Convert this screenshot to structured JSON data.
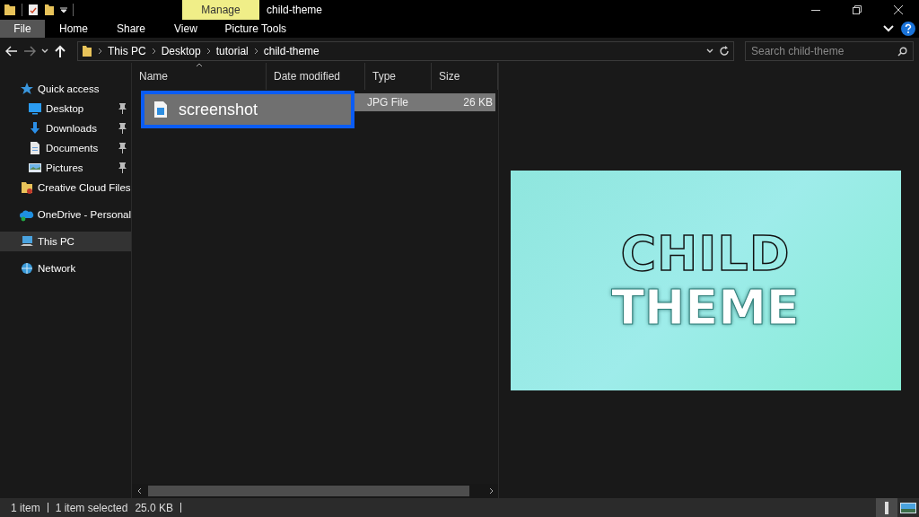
{
  "window": {
    "title": "child-theme",
    "context_group": "Manage"
  },
  "ribbon_tabs": [
    {
      "label": "File",
      "kind": "file"
    },
    {
      "label": "Home",
      "kind": "normal"
    },
    {
      "label": "Share",
      "kind": "normal"
    },
    {
      "label": "View",
      "kind": "normal"
    },
    {
      "label": "Picture Tools",
      "kind": "context"
    }
  ],
  "address": {
    "path": [
      "This PC",
      "Desktop",
      "tutorial",
      "child-theme"
    ]
  },
  "search": {
    "placeholder": "Search child-theme"
  },
  "sidebar": {
    "items": [
      {
        "label": "Quick access",
        "kind": "star",
        "selected": false,
        "children": [
          {
            "label": "Desktop",
            "kind": "desktop",
            "pinned": true,
            "selected": false
          },
          {
            "label": "Downloads",
            "kind": "download",
            "pinned": true,
            "selected": false
          },
          {
            "label": "Documents",
            "kind": "document",
            "pinned": true,
            "selected": false
          },
          {
            "label": "Pictures",
            "kind": "pictures",
            "pinned": true,
            "selected": false
          }
        ]
      },
      {
        "label": "Creative Cloud Files",
        "kind": "folder",
        "selected": false
      },
      {
        "label": "OneDrive - Personal",
        "kind": "cloud",
        "selected": false
      },
      {
        "label": "This PC",
        "kind": "pc",
        "selected": true
      },
      {
        "label": "Network",
        "kind": "network",
        "selected": false
      }
    ]
  },
  "file_list": {
    "columns": [
      {
        "label": "Name",
        "sorted": true
      },
      {
        "label": "Date modified",
        "sorted": false
      },
      {
        "label": "Type",
        "sorted": false
      },
      {
        "label": "Size",
        "sorted": false
      }
    ],
    "rows": [
      {
        "name": "screenshot",
        "type": "JPG File",
        "size": "26 KB",
        "selected": true,
        "renaming": true
      }
    ]
  },
  "preview": {
    "line_1": "CHILD",
    "line_2": "THEME"
  },
  "status_bar": {
    "item_count": "1 item",
    "selection": "1 item selected",
    "size": "25.0 KB"
  },
  "view_buttons": [
    {
      "kind": "details",
      "selected": true
    },
    {
      "kind": "large-icons",
      "selected": false
    }
  ]
}
